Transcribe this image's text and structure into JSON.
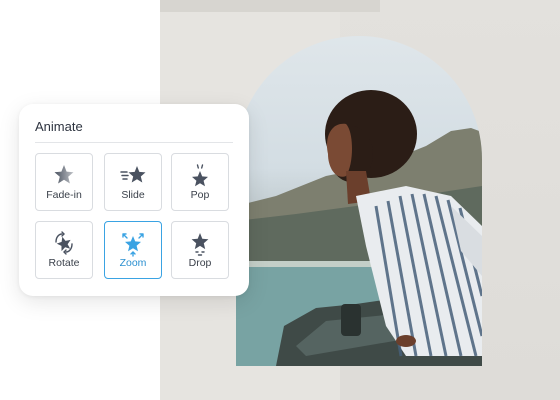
{
  "animate_panel": {
    "title": "Animate",
    "selected": "Zoom",
    "options": [
      {
        "label": "Fade-in",
        "icon": "star-fade-in-icon"
      },
      {
        "label": "Slide",
        "icon": "star-slide-icon"
      },
      {
        "label": "Pop",
        "icon": "star-pop-icon"
      },
      {
        "label": "Rotate",
        "icon": "star-rotate-icon"
      },
      {
        "label": "Zoom",
        "icon": "star-zoom-icon"
      },
      {
        "label": "Drop",
        "icon": "star-drop-icon"
      }
    ]
  },
  "colors": {
    "accent": "#3aa3e3",
    "icon": "#4a5260"
  }
}
